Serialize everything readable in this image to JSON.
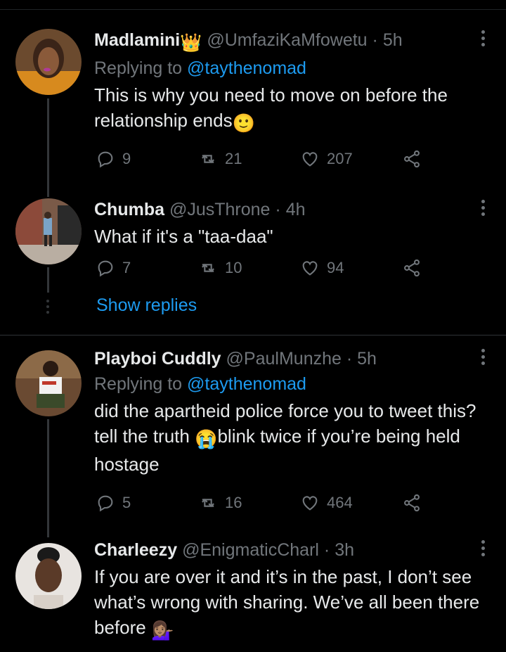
{
  "tweets": [
    {
      "name": "Madlamini",
      "name_emoji": "👑",
      "handle": "@UmfaziKaMfowetu",
      "dot": "·",
      "time": "5h",
      "replying_prefix": "Replying to ",
      "replying_to": "@taythenomad",
      "text": "This is why you need to move on before the relationship ends",
      "text_emoji": "🙂",
      "replies": "9",
      "retweets": "21",
      "likes": "207"
    },
    {
      "name": "Chumba",
      "handle": "@JusThrone",
      "dot": "·",
      "time": "4h",
      "text": "What if it's a \"taa-daa\"",
      "replies": "7",
      "retweets": "10",
      "likes": "94"
    },
    {
      "name": "Playboi Cuddly",
      "handle": "@PaulMunzhe",
      "dot": "·",
      "time": "5h",
      "replying_prefix": "Replying to ",
      "replying_to": "@taythenomad",
      "text_a": "did the apartheid police force you to tweet this? tell the truth ",
      "text_emoji": "😭",
      "text_b": "blink twice if you’re being held hostage",
      "replies": "5",
      "retweets": "16",
      "likes": "464"
    },
    {
      "name": "Charleezy",
      "handle": "@EnigmaticCharl",
      "dot": "·",
      "time": "3h",
      "text": "If you are over it and it’s in the past, I don’t see what’s wrong with sharing. We’ve all been there before ",
      "text_emoji": "💁🏽‍♀️"
    }
  ],
  "show_replies": "Show replies",
  "colors": {
    "background": "#000000",
    "text": "#e7e9ea",
    "muted": "#71767b",
    "link": "#1d9bf0"
  }
}
